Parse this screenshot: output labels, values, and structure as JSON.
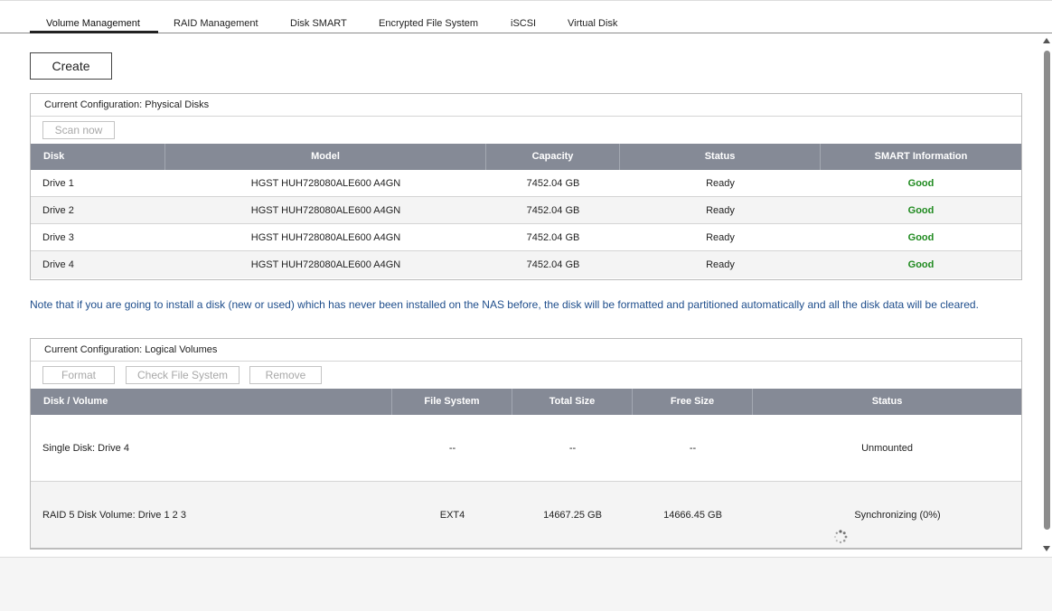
{
  "tabs": [
    {
      "label": "Volume Management",
      "active": true
    },
    {
      "label": "RAID Management",
      "active": false
    },
    {
      "label": "Disk SMART",
      "active": false
    },
    {
      "label": "Encrypted File System",
      "active": false
    },
    {
      "label": "iSCSI",
      "active": false
    },
    {
      "label": "Virtual Disk",
      "active": false
    }
  ],
  "create_label": "Create",
  "physical": {
    "title": "Current Configuration: Physical Disks",
    "scan_label": "Scan now",
    "columns": [
      "Disk",
      "Model",
      "Capacity",
      "Status",
      "SMART Information"
    ],
    "rows": [
      {
        "disk": "Drive 1",
        "model": "HGST HUH728080ALE600 A4GN",
        "capacity": "7452.04 GB",
        "status": "Ready",
        "smart": "Good"
      },
      {
        "disk": "Drive 2",
        "model": "HGST HUH728080ALE600 A4GN",
        "capacity": "7452.04 GB",
        "status": "Ready",
        "smart": "Good"
      },
      {
        "disk": "Drive 3",
        "model": "HGST HUH728080ALE600 A4GN",
        "capacity": "7452.04 GB",
        "status": "Ready",
        "smart": "Good"
      },
      {
        "disk": "Drive 4",
        "model": "HGST HUH728080ALE600 A4GN",
        "capacity": "7452.04 GB",
        "status": "Ready",
        "smart": "Good"
      }
    ]
  },
  "note": "Note that if you are going to install a disk (new or used) which has never been installed on the NAS before, the disk will be formatted and partitioned automatically and all the disk data will be cleared.",
  "logical": {
    "title": "Current Configuration: Logical Volumes",
    "buttons": {
      "format": "Format",
      "check": "Check File System",
      "remove": "Remove"
    },
    "columns": [
      "Disk / Volume",
      "File System",
      "Total Size",
      "Free Size",
      "Status"
    ],
    "rows": [
      {
        "volume": "Single Disk: Drive 4",
        "fs": "--",
        "total": "--",
        "free": "--",
        "status": "Unmounted",
        "syncing": false
      },
      {
        "volume": "RAID 5 Disk Volume: Drive 1 2 3",
        "fs": "EXT4",
        "total": "14667.25 GB",
        "free": "14666.45 GB",
        "status": "Synchronizing (0%)",
        "syncing": true
      }
    ]
  },
  "colors": {
    "header_bg": "#858a96",
    "good": "#1f8a1f",
    "note": "#1f4e8c"
  }
}
